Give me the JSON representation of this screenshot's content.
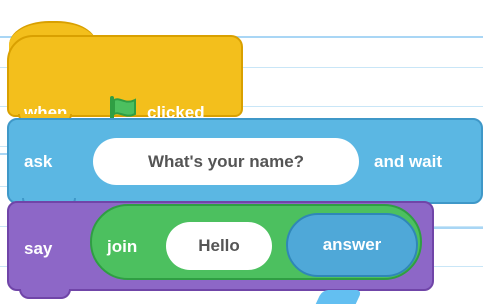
{
  "ui": {
    "hat_block": {
      "label_left": "when",
      "label_right": "clicked",
      "icon": "green-flag-icon",
      "color": "#f3bf1c",
      "stroke": "#d9a000"
    },
    "ask_block": {
      "label": "ask",
      "input_value": "What's your name?",
      "trailing_label": "and wait",
      "color": "#5bb7e3",
      "stroke": "#3f98c8"
    },
    "say_block": {
      "label": "say",
      "join_label": "join",
      "join_first_value": "Hello",
      "join_second_label": "answer",
      "color": "#8d67c7",
      "stroke": "#7045a8"
    },
    "join_reporter": {
      "color": "#4cc05f",
      "stroke": "#2f9e43"
    },
    "answer_reporter": {
      "color": "#4fa8d8",
      "stroke": "#2f87b7"
    },
    "guides_color": "#c9e6f7"
  }
}
